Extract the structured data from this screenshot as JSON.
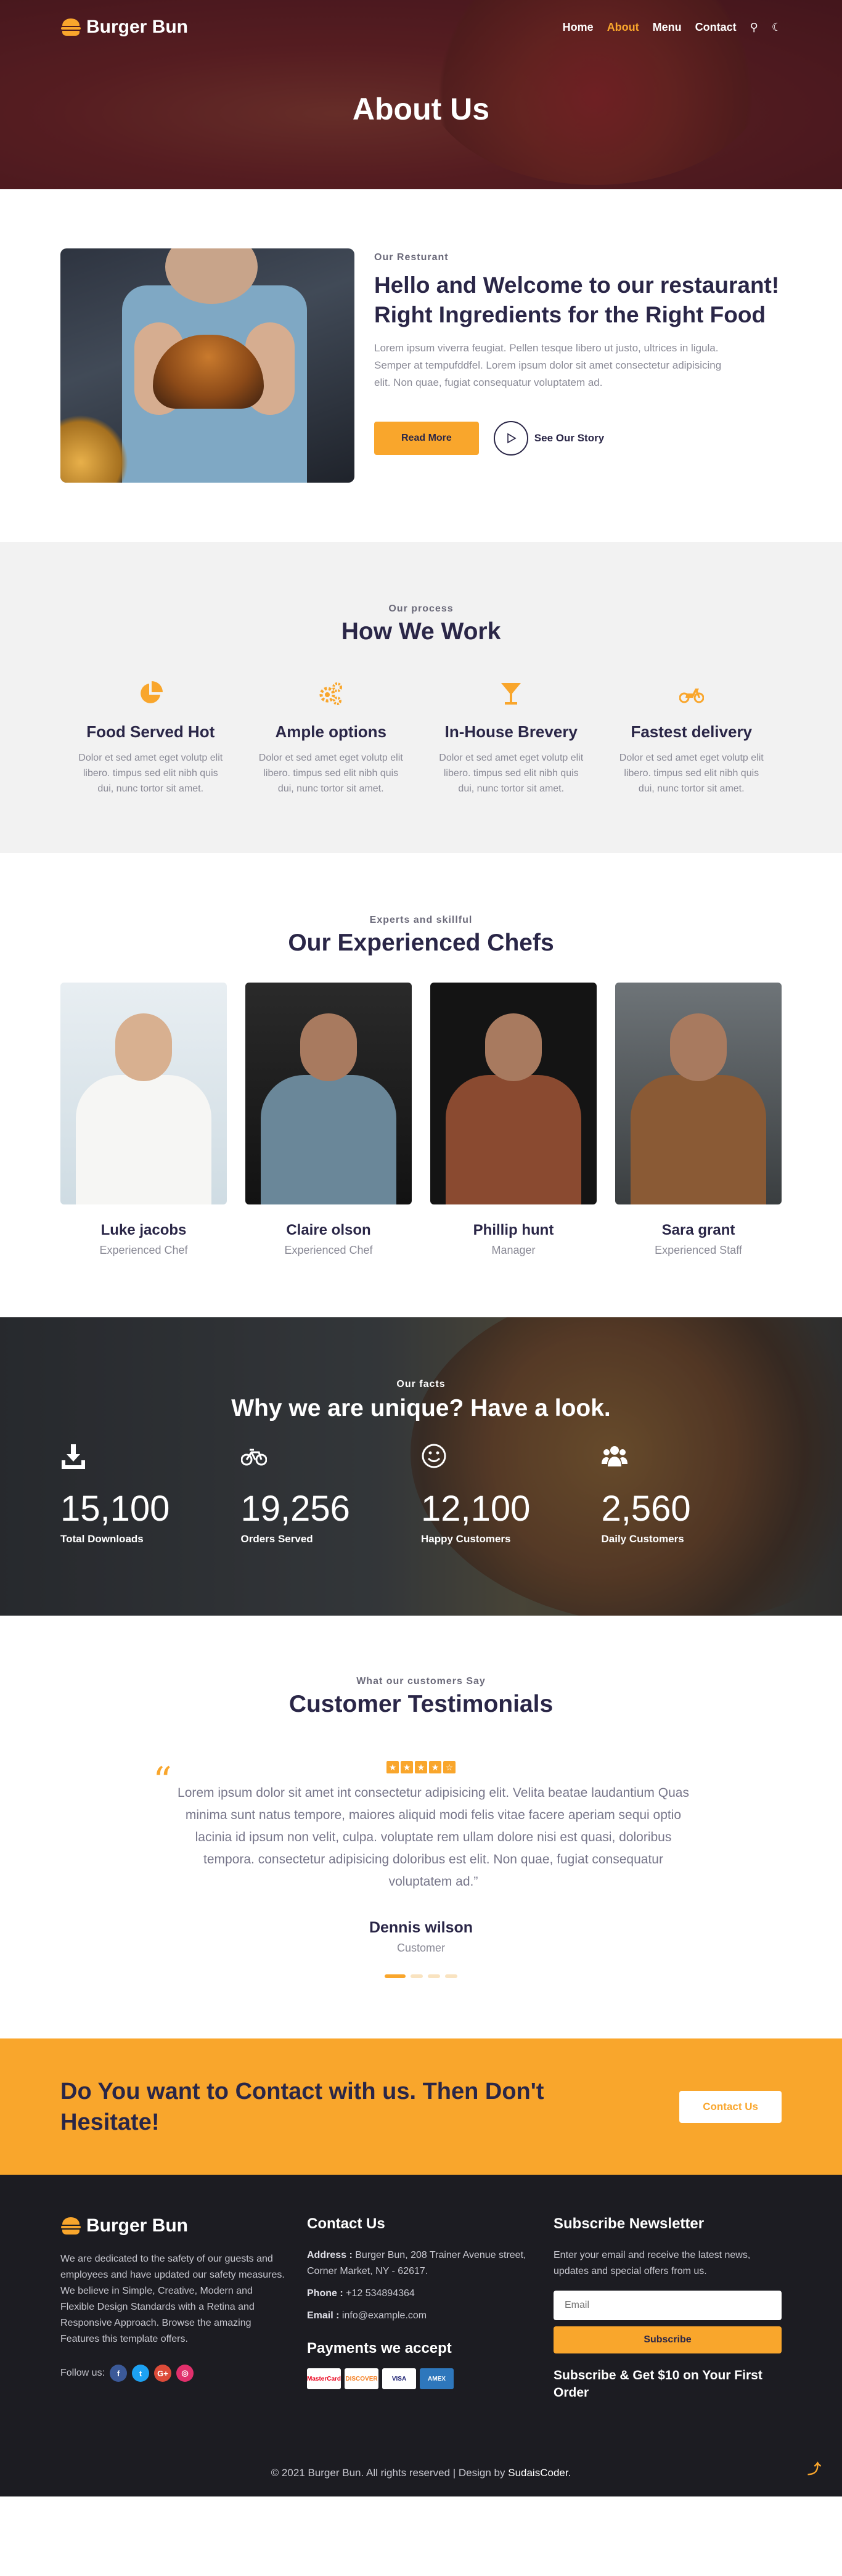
{
  "brand": {
    "name": "Burger Bun"
  },
  "nav": {
    "items": [
      "Home",
      "About",
      "Menu",
      "Contact"
    ],
    "active": "About"
  },
  "hero": {
    "title": "About Us"
  },
  "about": {
    "eyebrow": "Our Resturant",
    "title": "Hello and Welcome to our restaurant! Right Ingredients for the Right Food",
    "body": "Lorem ipsum viverra feugiat. Pellen tesque libero ut justo, ultrices in ligula. Semper at tempufddfel. Lorem ipsum dolor sit amet consectetur adipisicing elit. Non quae, fugiat consequatur voluptatem ad.",
    "read_more": "Read More",
    "see_story": "See Our Story"
  },
  "process": {
    "eyebrow": "Our process",
    "title": "How We Work",
    "items": [
      {
        "icon": "pie-chart-icon",
        "title": "Food Served Hot",
        "text": "Dolor et sed amet eget volutp elit libero. timpus sed elit nibh quis dui, nunc tortor sit amet."
      },
      {
        "icon": "gears-icon",
        "title": "Ample options",
        "text": "Dolor et sed amet eget volutp elit libero. timpus sed elit nibh quis dui, nunc tortor sit amet."
      },
      {
        "icon": "cocktail-icon",
        "title": "In-House Brevery",
        "text": "Dolor et sed amet eget volutp elit libero. timpus sed elit nibh quis dui, nunc tortor sit amet."
      },
      {
        "icon": "motorcycle-icon",
        "title": "Fastest delivery",
        "text": "Dolor et sed amet eget volutp elit libero. timpus sed elit nibh quis dui, nunc tortor sit amet."
      }
    ]
  },
  "chefs": {
    "eyebrow": "Experts and skillful",
    "title": "Our Experienced Chefs",
    "items": [
      {
        "name": "Luke jacobs",
        "role": "Experienced Chef"
      },
      {
        "name": "Claire olson",
        "role": "Experienced Chef"
      },
      {
        "name": "Phillip hunt",
        "role": "Manager"
      },
      {
        "name": "Sara grant",
        "role": "Experienced Staff"
      }
    ]
  },
  "facts": {
    "eyebrow": "Our facts",
    "title": "Why we are unique? Have a look.",
    "items": [
      {
        "icon": "download-icon",
        "value": "15,100",
        "label": "Total Downloads"
      },
      {
        "icon": "bicycle-icon",
        "value": "19,256",
        "label": "Orders Served"
      },
      {
        "icon": "smile-icon",
        "value": "12,100",
        "label": "Happy Customers"
      },
      {
        "icon": "users-icon",
        "value": "2,560",
        "label": "Daily Customers"
      }
    ]
  },
  "testimonials": {
    "eyebrow": "What our customers Say",
    "title": "Customer Testimonials",
    "rating": 4.5,
    "quote": "Lorem ipsum dolor sit amet int consectetur adipisicing elit. Velita beatae laudantium Quas minima sunt natus tempore, maiores aliquid modi felis vitae facere aperiam sequi optio lacinia id ipsum non velit, culpa. voluptate rem ullam dolore nisi est quasi, doloribus tempora. consectetur adipisicing doloribus est elit. Non quae, fugiat consequatur voluptatem ad.”",
    "name": "Dennis wilson",
    "role": "Customer",
    "slides": 4,
    "active_slide": 1
  },
  "cta": {
    "title": "Do You want to Contact with us. Then Don't Hesitate!",
    "button": "Contact Us"
  },
  "footer": {
    "about": "We are dedicated to the safety of our guests and employees and have updated our safety measures. We believe in Simple, Creative, Modern and Flexible Design Standards with a Retina and Responsive Approach. Browse the amazing Features this template offers.",
    "follow": "Follow us:",
    "contact_title": "Contact Us",
    "address_label": "Address :",
    "address": "Burger Bun, 208 Trainer Avenue street, Corner Market, NY - 62617.",
    "phone_label": "Phone :",
    "phone": "+12 534894364",
    "email_label": "Email :",
    "email": "info@example.com",
    "payments_title": "Payments we accept",
    "cards": [
      "MasterCard",
      "DISCOVER",
      "VISA",
      "AMEX"
    ],
    "newsletter_title": "Subscribe Newsletter",
    "newsletter_text": "Enter your email and receive the latest news, updates and special offers from us.",
    "email_placeholder": "Email",
    "subscribe": "Subscribe",
    "promo": "Subscribe & Get $10 on Your First Order",
    "copyright": "© 2021 Burger Bun. All rights reserved | Design by",
    "designer": "SudaisCoder."
  },
  "colors": {
    "accent": "#f9a62c",
    "dark": "#2a2647",
    "footer": "#1c1c22"
  }
}
